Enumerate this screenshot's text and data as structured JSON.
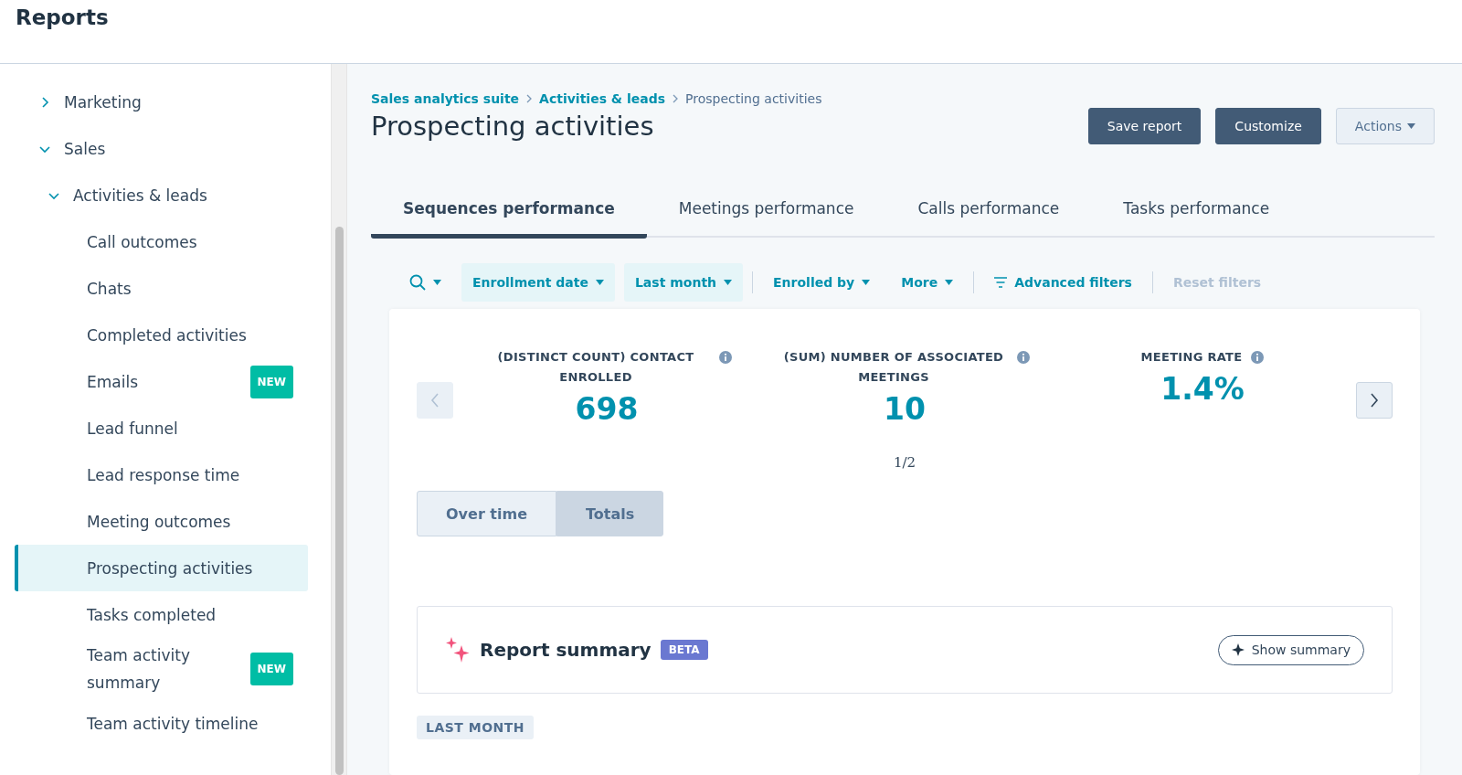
{
  "header": {
    "title": "Reports"
  },
  "sidebar": {
    "items": [
      {
        "label": "Marketing",
        "expanded": false
      },
      {
        "label": "Sales",
        "expanded": true,
        "children": [
          {
            "label": "Activities & leads",
            "expanded": true,
            "children": [
              {
                "label": "Call outcomes",
                "selected": false
              },
              {
                "label": "Chats",
                "selected": false
              },
              {
                "label": "Completed activities",
                "selected": false
              },
              {
                "label": "Emails",
                "selected": false,
                "badge": "NEW"
              },
              {
                "label": "Lead funnel",
                "selected": false
              },
              {
                "label": "Lead response time",
                "selected": false
              },
              {
                "label": "Meeting outcomes",
                "selected": false
              },
              {
                "label": "Prospecting activities",
                "selected": true
              },
              {
                "label": "Tasks completed",
                "selected": false
              },
              {
                "label": "Team activity summary",
                "selected": false,
                "badge": "NEW"
              },
              {
                "label": "Team activity timeline",
                "selected": false
              }
            ]
          }
        ]
      }
    ]
  },
  "breadcrumbs": [
    {
      "label": "Sales analytics suite",
      "kind": "link"
    },
    {
      "label": "Activities & leads",
      "kind": "link"
    },
    {
      "label": "Prospecting activities",
      "kind": "current"
    }
  ],
  "page_title": "Prospecting activities",
  "actions": [
    {
      "label": "Save report",
      "kind": "primary"
    },
    {
      "label": "Customize",
      "kind": "primary"
    },
    {
      "label": "Actions",
      "kind": "dropdown"
    }
  ],
  "tabs": [
    {
      "label": "Sequences performance",
      "selected": true
    },
    {
      "label": "Meetings performance",
      "selected": false
    },
    {
      "label": "Calls performance",
      "selected": false
    },
    {
      "label": "Tasks performance",
      "selected": false
    }
  ],
  "filters": [
    {
      "kind": "search"
    },
    {
      "kind": "chip",
      "label": "Enrollment date"
    },
    {
      "kind": "chip",
      "label": "Last month"
    },
    {
      "kind": "divider"
    },
    {
      "kind": "menu",
      "label": "Enrolled by"
    },
    {
      "kind": "menu",
      "label": "More"
    },
    {
      "kind": "divider"
    },
    {
      "kind": "advanced",
      "label": "Advanced filters"
    },
    {
      "kind": "divider"
    },
    {
      "kind": "reset",
      "label": "Reset filters",
      "disabled": true
    }
  ],
  "kpis": [
    {
      "label": "(DISTINCT COUNT) CONTACT ENROLLED",
      "value": "698"
    },
    {
      "label": "(SUM) NUMBER OF ASSOCIATED MEETINGS",
      "value": "10"
    },
    {
      "label": "MEETING RATE",
      "value": "1.4%"
    }
  ],
  "pager": "1/2",
  "view_toggle": [
    {
      "label": "Over time",
      "selected": false
    },
    {
      "label": "Totals",
      "selected": true
    }
  ],
  "summary": {
    "title": "Report summary",
    "badge": "BETA",
    "button": "Show summary"
  },
  "period_tag": "LAST MONTH"
}
